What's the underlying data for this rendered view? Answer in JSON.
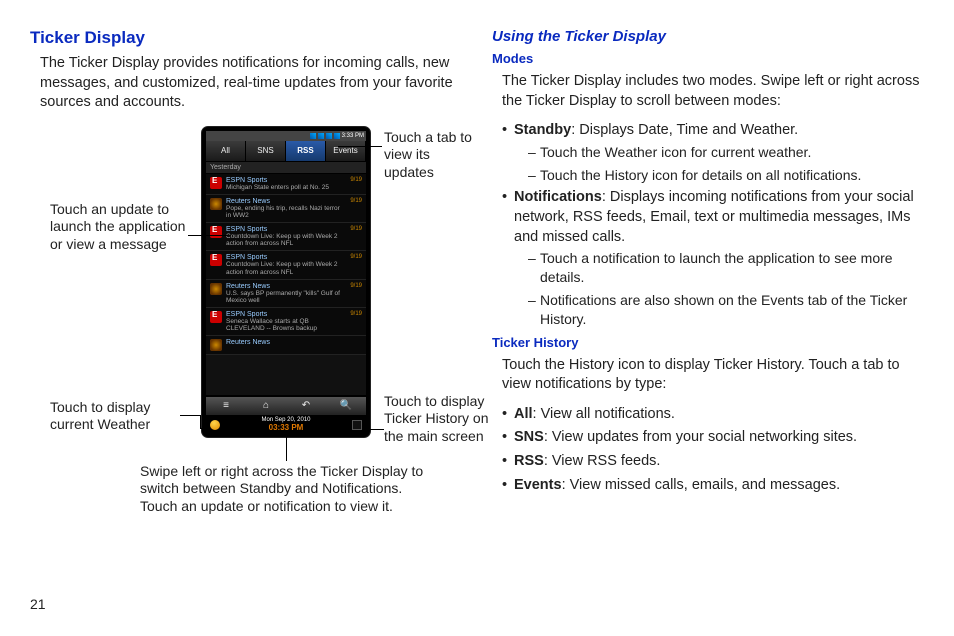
{
  "left": {
    "heading": "Ticker Display",
    "intro": "The Ticker Display provides notifications for incoming calls, new messages, and customized, real-time updates from your favorite sources and accounts."
  },
  "phone": {
    "status_time": "3:33 PM",
    "tabs": {
      "all": "All",
      "sns": "SNS",
      "rss": "RSS",
      "events": "Events"
    },
    "divider": "Yesterday",
    "items": [
      {
        "ico": "espn",
        "src": "ESPN Sports",
        "headline": "Michigan State enters poll at No. 25",
        "date": "9/19"
      },
      {
        "ico": "reuters",
        "src": "Reuters News",
        "headline": "Pope, ending his trip, recalls Nazi terror in WW2",
        "date": "9/19"
      },
      {
        "ico": "espn",
        "src": "ESPN Sports",
        "headline": "Countdown Live: Keep up with Week 2 action from across NFL",
        "date": "9/19"
      },
      {
        "ico": "espn",
        "src": "ESPN Sports",
        "headline": "Countdown Live: Keep up with Week 2 action from across NFL",
        "date": "9/19"
      },
      {
        "ico": "reuters",
        "src": "Reuters News",
        "headline": "U.S. says BP permanently \"kills\" Gulf of Mexico well",
        "date": "9/19"
      },
      {
        "ico": "espn",
        "src": "ESPN Sports",
        "headline": "Seneca Wallace starts at QB CLEVELAND -- Browns backup",
        "date": "9/19"
      },
      {
        "ico": "reuters",
        "src": "Reuters News",
        "headline": "",
        "date": ""
      }
    ],
    "ticker": {
      "date": "Mon Sep  20, 2010",
      "time": "03:33 PM"
    }
  },
  "callouts": {
    "tab": "Touch a tab to view its updates",
    "update": "Touch an update to launch the application or view a message",
    "weather": "Touch to display current Weather",
    "history": "Touch to display Ticker History on the main screen",
    "swipe": "Swipe left or right across the Ticker Display to switch between Standby and Notifications. Touch an update or notification to view it."
  },
  "right": {
    "heading": "Using the Ticker Display",
    "modes_heading": "Modes",
    "modes_intro": "The Ticker Display includes two modes. Swipe left or right across the Ticker Display to scroll between modes:",
    "bullets": {
      "standby_label": "Standby",
      "standby_text": ": Displays Date, Time and Weather.",
      "standby_sub1": "Touch the Weather icon for current weather.",
      "standby_sub2": "Touch the History icon for details on all notifications.",
      "notif_label": "Notifications",
      "notif_text": ": Displays incoming notifications from your social network, RSS feeds, Email, text or multimedia messages, IMs and missed calls.",
      "notif_sub1": "Touch a notification to launch the application to see more details.",
      "notif_sub2": "Notifications are also shown on the Events tab of the Ticker History."
    },
    "history_heading": "Ticker History",
    "history_intro": "Touch the History icon to display Ticker History. Touch a tab to view notifications by type:",
    "history_bullets": {
      "all_label": "All",
      "all_text": ": View all notifications.",
      "sns_label": "SNS",
      "sns_text": ": View updates from your social networking sites.",
      "rss_label": "RSS",
      "rss_text": ": View RSS feeds.",
      "events_label": "Events",
      "events_text": ": View missed calls, emails, and messages."
    }
  },
  "page_number": "21"
}
